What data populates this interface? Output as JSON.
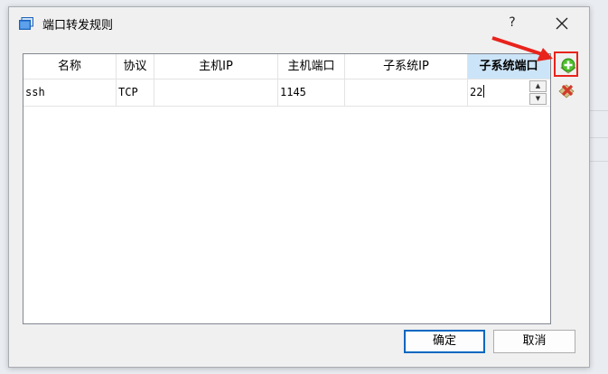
{
  "dialog": {
    "title": "端口转发规则",
    "help_label": "?",
    "close_icon": "close-icon",
    "app_icon": "windows-icon"
  },
  "table": {
    "columns": [
      "名称",
      "协议",
      "主机IP",
      "主机端口",
      "子系统IP",
      "子系统端口"
    ],
    "active_column": "子系统端口",
    "rows": [
      {
        "name": "ssh",
        "protocol": "TCP",
        "host_ip": "",
        "host_port": "1145",
        "guest_ip": "",
        "guest_port": "22"
      }
    ]
  },
  "side_buttons": {
    "add_icon": "add-rule-icon",
    "remove_icon": "remove-rule-icon"
  },
  "annotation": {
    "color": "#e8231c"
  },
  "buttons": {
    "ok": "确定",
    "cancel": "取消"
  }
}
